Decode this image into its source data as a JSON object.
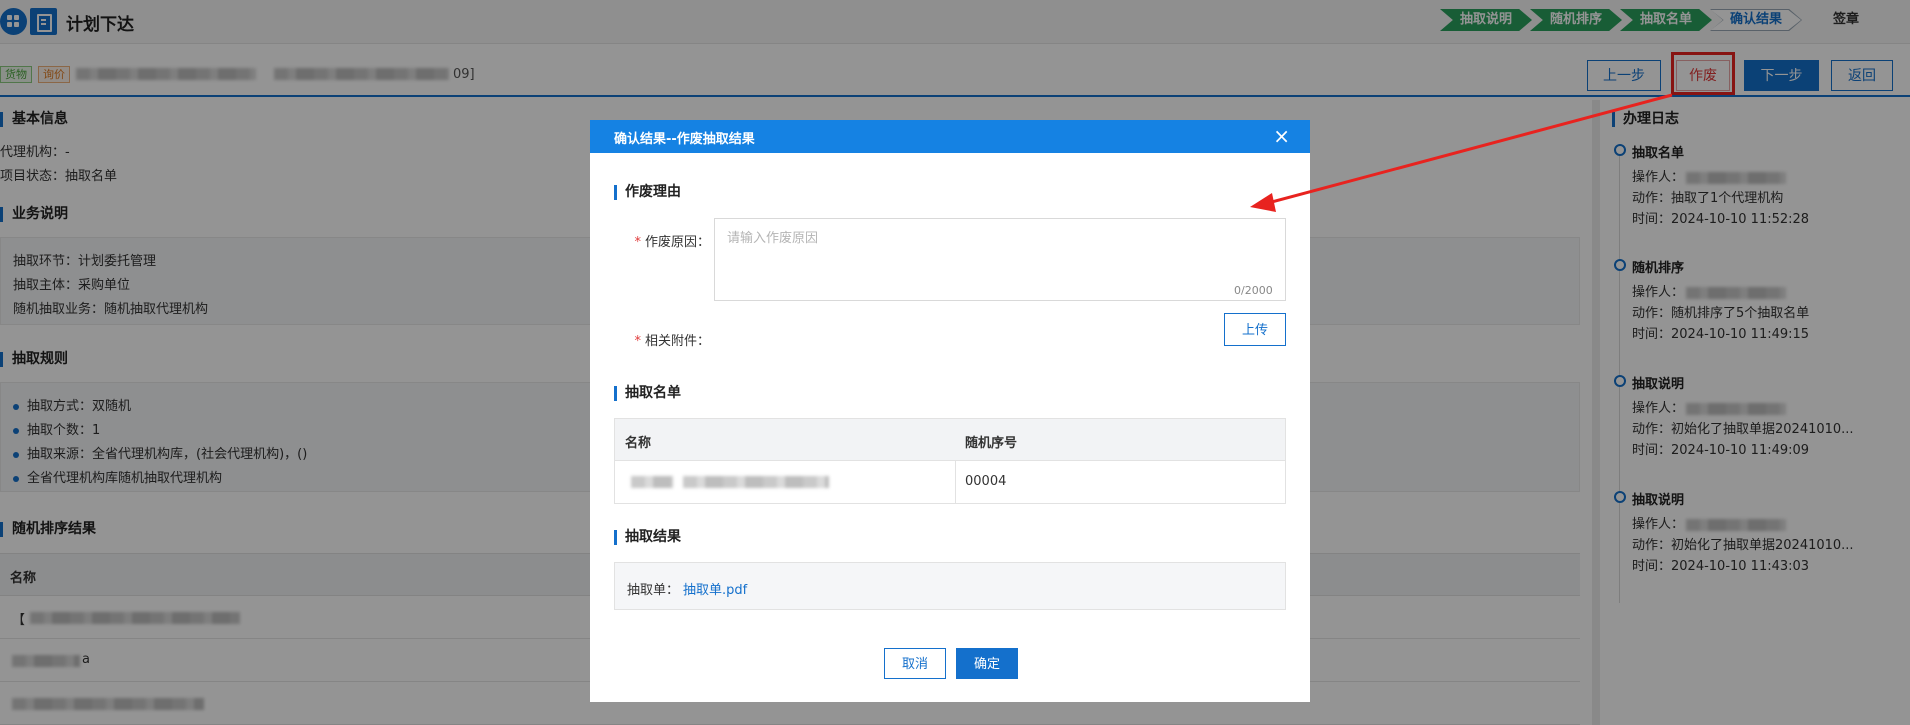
{
  "header": {
    "title": "计划下达",
    "steps": [
      "抽取说明",
      "随机排序",
      "抽取名单",
      "确认结果",
      "签章"
    ]
  },
  "project": {
    "tags": [
      "货物",
      "询价"
    ],
    "name_tail": "09]"
  },
  "actions": {
    "prev": "上一步",
    "void": "作废",
    "next": "下一步",
    "back": "返回"
  },
  "basic_info": {
    "title": "基本信息",
    "agency": "代理机构：-",
    "status": "项目状态：抽取名单"
  },
  "business": {
    "title": "业务说明",
    "rows": [
      "抽取环节：计划委托管理",
      "抽取主体：采购单位",
      "随机抽取业务：随机抽取代理机构"
    ]
  },
  "rules": {
    "title": "抽取规则",
    "rows": [
      "抽取方式：双随机",
      "抽取个数：1",
      "抽取来源：全省代理机构库，(社会代理机构)，()",
      "全省代理机构库随机抽取代理机构"
    ]
  },
  "random_result": {
    "title": "随机排序结果",
    "col_name": "名称",
    "row1_prefix": "【",
    "row2_suffix": "a",
    "partial_value": "00004"
  },
  "log": {
    "title": "办理日志",
    "items": [
      {
        "head": "抽取名单",
        "op": "操作人：",
        "action": "动作：抽取了1个代理机构",
        "time": "时间：2024-10-10 11:52:28"
      },
      {
        "head": "随机排序",
        "op": "操作人：",
        "action": "动作：随机排序了5个抽取名单",
        "time": "时间：2024-10-10 11:49:15"
      },
      {
        "head": "抽取说明",
        "op": "操作人：",
        "action": "动作：初始化了抽取单据20241010...",
        "time": "时间：2024-10-10 11:49:09"
      },
      {
        "head": "抽取说明",
        "op": "操作人：",
        "action": "动作：初始化了抽取单据20241010...",
        "time": "时间：2024-10-10 11:43:03"
      }
    ]
  },
  "modal": {
    "title": "确认结果--作废抽取结果",
    "close": "×",
    "reason_section": "作废理由",
    "reason_label": "作废原因：",
    "reason_placeholder": "请输入作废原因",
    "reason_value": "",
    "counter": "0/2000",
    "attach_label": "相关附件：",
    "upload": "上传",
    "list_section": "抽取名单",
    "table_headers": [
      "名称",
      "随机序号"
    ],
    "table_row_seq": "00004",
    "result_section": "抽取结果",
    "result_label": "抽取单：",
    "result_file": "抽取单.pdf",
    "cancel": "取消",
    "confirm": "确定"
  },
  "colors": {
    "primary": "#1470cc",
    "modal_header": "#1582e3",
    "step_done": "#2aa05e",
    "danger": "#e8231f"
  }
}
